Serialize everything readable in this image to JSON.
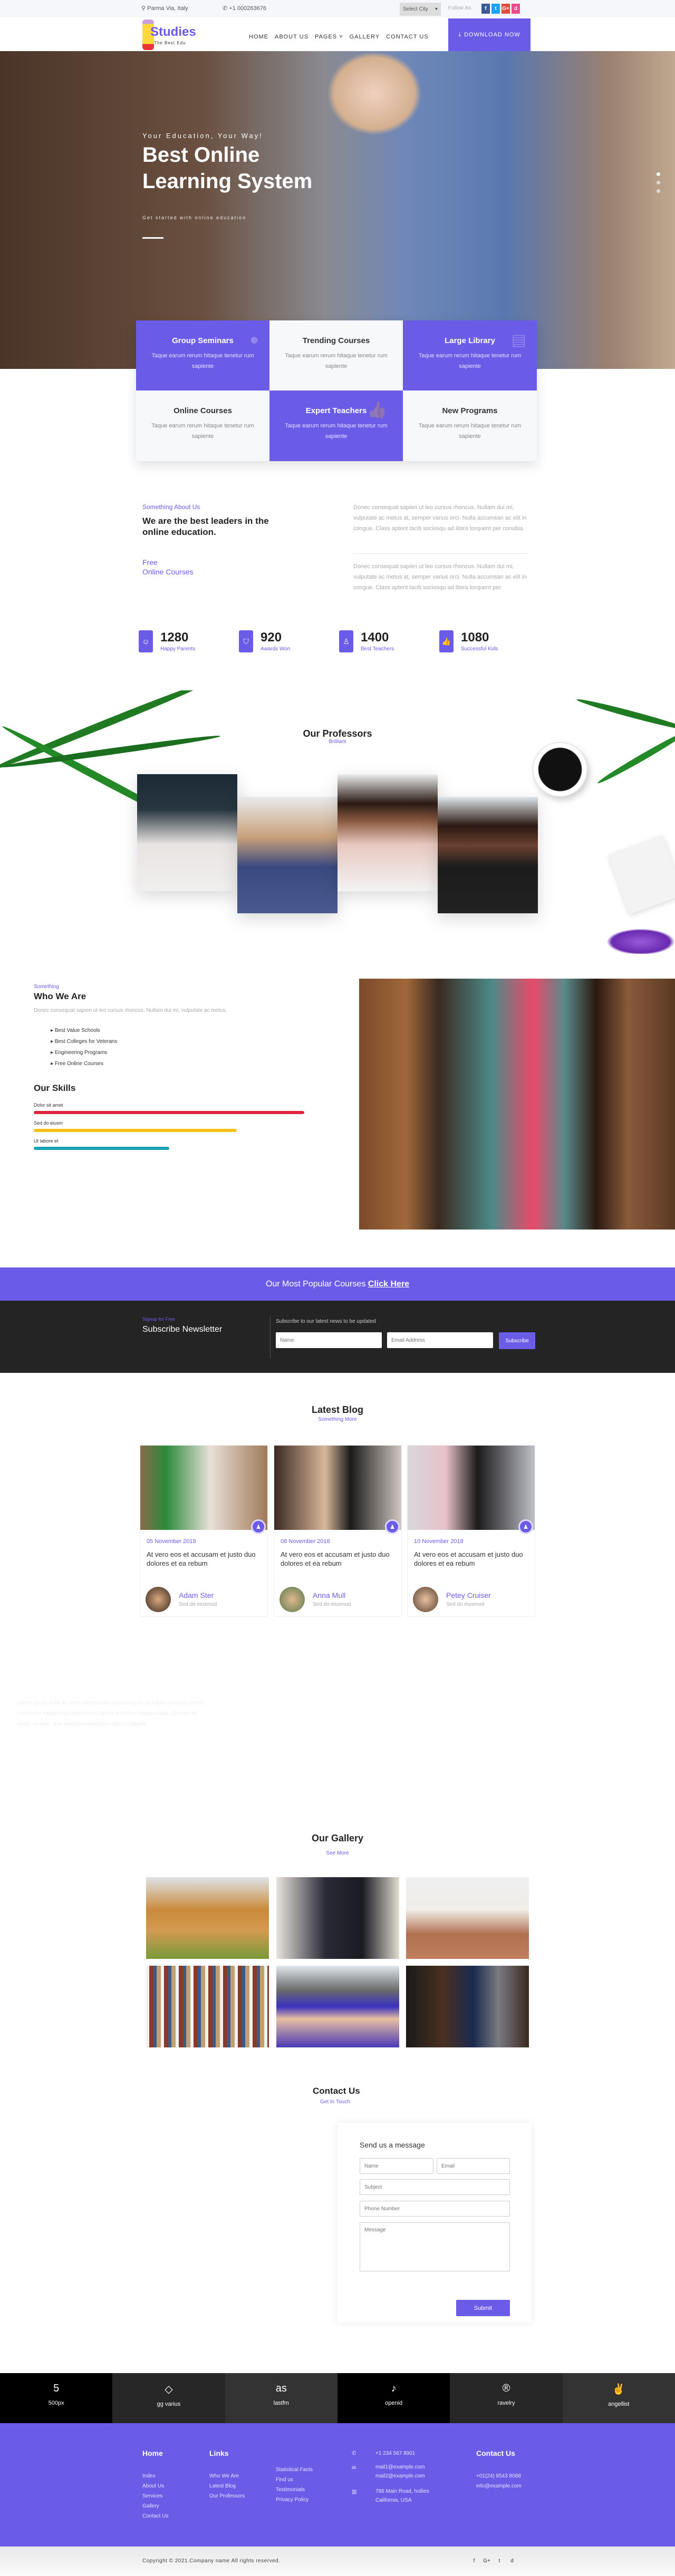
{
  "topbar": {
    "location": "Parma Via, Italy",
    "phone": "+1 000263676",
    "city_select": "Select City",
    "follow_label": "Follow As:",
    "social": [
      "f",
      "t",
      "G+",
      "d"
    ]
  },
  "nav": {
    "brand": "Studies",
    "tagline": "The Best Edu",
    "links": [
      "HOME",
      "ABOUT US",
      "PAGES",
      "GALLERY",
      "CONTACT US"
    ],
    "download": "DOWNLOAD NOW"
  },
  "hero": {
    "kicker": "Your Education, Your Way!",
    "title_line1": "Best Online",
    "title_line2": "Learning System",
    "subtitle": "Get started with online education",
    "slide_dots": 3,
    "active_slide": 1
  },
  "features": [
    {
      "title": "Group Seminars",
      "text": "Taque earum rerum hitaque tenetur rum sapiente",
      "style": "purple",
      "icon": "users-icon"
    },
    {
      "title": "Trending Courses",
      "text": "Taque earum rerum hitaque tenetur rum sapiente",
      "style": "light"
    },
    {
      "title": "Large Library",
      "text": "Taque earum rerum hitaque tenetur rum sapiente",
      "style": "purple",
      "icon": "book-icon"
    },
    {
      "title": "Online Courses",
      "text": "Taque earum rerum hitaque tenetur rum sapiente",
      "style": "light"
    },
    {
      "title": "Expert Teachers",
      "text": "Taque earum rerum hitaque tenetur rum sapiente",
      "style": "purple",
      "icon": "thumbs-up-icon"
    },
    {
      "title": "New Programs",
      "text": "Taque earum rerum hitaque tenetur rum sapiente",
      "style": "light"
    }
  ],
  "about": {
    "kicker": "Something About Us",
    "heading": "We are the best leaders in the online education.",
    "free_line1": "Free",
    "free_line2": "Online Courses",
    "para1": "Donec consequat sapien ut leo cursus rhoncus. Nullam dui mi, vulputate ac metus at, semper varius orci. Nulla accumsan ac elit in congue. Class aptent taciti sociosqu ad litora torquent per conubia.",
    "para2": "Donec consequat sapien ut leo cursus rhoncus. Nullam dui mi, vulputate ac metus at, semper varius orci. Nulla accumsan ac elit in congue. Class aptent taciti sociosqu ad litora torquent per."
  },
  "stats": [
    {
      "value": "1280",
      "label": "Happy Parents",
      "icon": "smile-icon"
    },
    {
      "value": "920",
      "label": "Awards Won",
      "icon": "shield-icon"
    },
    {
      "value": "1400",
      "label": "Best Teachers",
      "icon": "user-icon"
    },
    {
      "value": "1080",
      "label": "Successful Kids",
      "icon": "thumbs-up-icon"
    }
  ],
  "professors": {
    "title": "Our Professors",
    "subtitle": "Brilliant"
  },
  "who": {
    "kicker": "Something",
    "heading": "Who We Are",
    "text": "Donec consequat sapien ut leo cursus rhoncus. Nullam dui mi, vulputate ac metus.",
    "list": [
      "Best Value Schools",
      "Best Colleges for Veterans",
      "Engineering Programs",
      "Free Online Courses"
    ],
    "skills_title": "Our Skills",
    "skills": [
      {
        "label": "Dolor sit amet",
        "percent": 100,
        "color": "#e0263f"
      },
      {
        "label": "Sed do eiusm",
        "percent": 75,
        "color": "#f5c016"
      },
      {
        "label": "Ut labore et",
        "percent": 50,
        "color": "#17a2b0"
      }
    ]
  },
  "popular": {
    "text": "Our Most Popular Courses",
    "link": "Click Here"
  },
  "newsletter": {
    "kicker": "Signup for Free",
    "heading": "Subscribe Newsletter",
    "note": "Subscribe to our latest news to be updated",
    "name_placeholder": "Name",
    "email_placeholder": "Email Address",
    "button": "Subscribe"
  },
  "blog": {
    "title": "Latest Blog",
    "subtitle": "Something More",
    "posts": [
      {
        "date": "05 November 2018",
        "title": "At vero eos et accusam et justo duo dolores et ea rebum",
        "author": "Adam Ster",
        "role": "Sed do eiusmod"
      },
      {
        "date": "08 November 2018",
        "title": "At vero eos et accusam et justo duo dolores et ea rebum",
        "author": "Anna Mull",
        "role": "Sed do eiusmod"
      },
      {
        "date": "10 November 2018",
        "title": "At vero eos et accusam et justo duo dolores et ea rebum",
        "author": "Petey Cruiser",
        "role": "Sed do eiusmod"
      }
    ]
  },
  "faint_text": [
    "Lorem ipsum dolor sit amet consectetur adipisicing elit sed diam nonumy eirmod",
    "consetetur sadipscing incididunt ut labore et dolore magna aliqua. Ut enim ad",
    "minim veniam, quis nostrud exercitation ullamco laboris"
  ],
  "gallery": {
    "title": "Our Gallery",
    "subtitle": "See More"
  },
  "contact": {
    "title": "Contact Us",
    "subtitle": "Get In Touch",
    "form_title": "Send us a message",
    "name": "Name",
    "email": "Email",
    "subject": "Subject",
    "phone": "Phone Number",
    "message": "Message",
    "submit": "Submit"
  },
  "icon_strip": [
    {
      "label": "500px",
      "glyph": "5"
    },
    {
      "label": "gg varius",
      "glyph": "◇"
    },
    {
      "label": "lastfm",
      "glyph": "as"
    },
    {
      "label": "openid",
      "glyph": "♪"
    },
    {
      "label": "ravelry",
      "glyph": "®"
    },
    {
      "label": "angellist",
      "glyph": "✌"
    }
  ],
  "footer": {
    "home_title": "Home",
    "home_links": [
      "Index",
      "About Us",
      "Services",
      "Gallery",
      "Contact Us"
    ],
    "links_title": "Links",
    "links": [
      "Who We Are",
      "Latest Blog",
      "Our Professors"
    ],
    "more_links": [
      "Statistical Facts",
      "Find us",
      "Testimonials",
      "Privacy Policy"
    ],
    "phone": "+1 234 567 8901",
    "mail1": "mail1@example.com",
    "mail2": "mail2@example.com",
    "addr1": "786 Main Road, hollies",
    "addr2": "California, USA",
    "contact_title": "Contact Us",
    "contact_phone": "+01(24) 8543 8088",
    "contact_email": "info@example.com"
  },
  "copyright": {
    "text": "Copyright © 2021.Company name All rights reserved.",
    "social": [
      "f",
      "G+",
      "t",
      "d"
    ]
  },
  "colors": {
    "accent": "#6b5ce7",
    "dark": "#242424"
  }
}
